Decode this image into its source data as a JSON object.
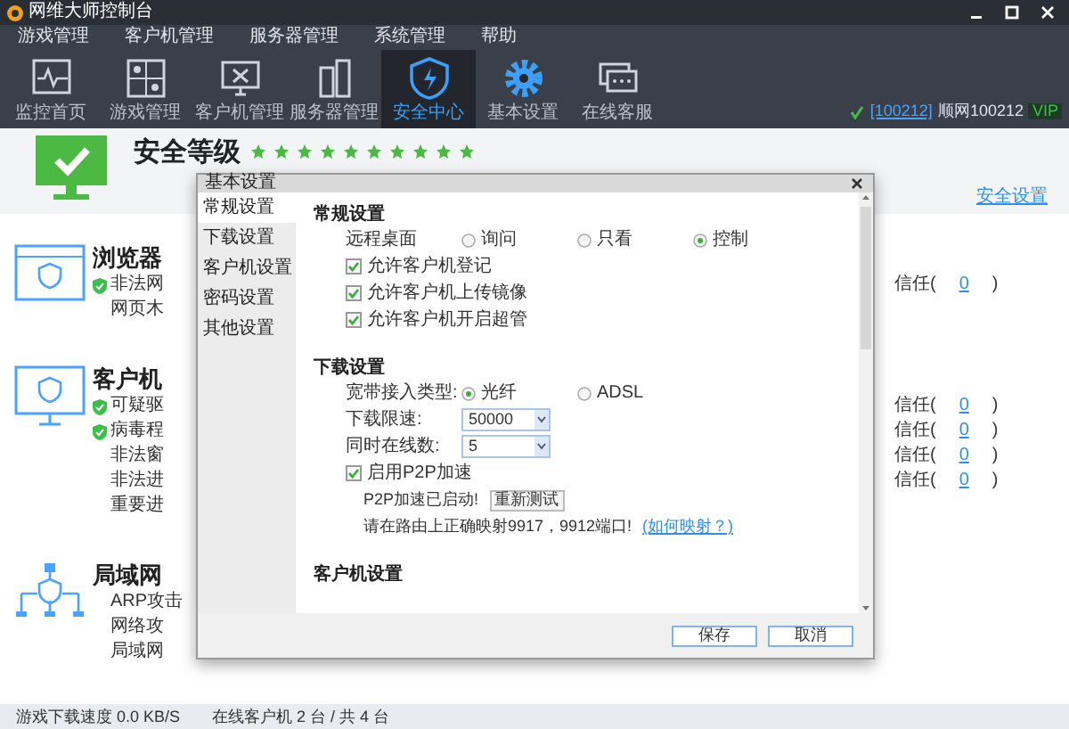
{
  "window": {
    "title": "网维大师控制台"
  },
  "menu": [
    "游戏管理",
    "客户机管理",
    "服务器管理",
    "系统管理",
    "帮助"
  ],
  "toolbar": [
    {
      "label": "监控首页",
      "kind": "monitor",
      "selected": false
    },
    {
      "label": "游戏管理",
      "kind": "games",
      "selected": false
    },
    {
      "label": "客户机管理",
      "kind": "client",
      "selected": false
    },
    {
      "label": "服务器管理",
      "kind": "server",
      "selected": false
    },
    {
      "label": "安全中心",
      "kind": "shield",
      "selected": true
    },
    {
      "label": "基本设置",
      "kind": "gear",
      "selected": false
    },
    {
      "label": "在线客服",
      "kind": "chat",
      "selected": false
    }
  ],
  "account": {
    "id": "[100212]",
    "name": "顺网100212",
    "badge": "VIP"
  },
  "security": {
    "title": "安全等级",
    "stars": 10,
    "settings_link": "安全设置",
    "sections": [
      {
        "kind": "browser",
        "title": "浏览器",
        "items": [
          {
            "text": "非法网",
            "shield": true,
            "trust": {
              "label": "信任(",
              "count": "0",
              "suffix": ")"
            }
          },
          {
            "text": "网页木",
            "shield": false
          }
        ]
      },
      {
        "kind": "client",
        "title": "客户机",
        "items": [
          {
            "text": "可疑驱",
            "shield": true,
            "trust": {
              "label": "信任(",
              "count": "0",
              "suffix": ")"
            }
          },
          {
            "text": "病毒程",
            "shield": true,
            "trust": {
              "label": "信任(",
              "count": "0",
              "suffix": ")"
            }
          },
          {
            "text": "非法窗",
            "shield": false,
            "trust": {
              "label": "信任(",
              "count": "0",
              "suffix": ")"
            }
          },
          {
            "text": "非法进",
            "shield": false,
            "trust": {
              "label": "信任(",
              "count": "0",
              "suffix": ")"
            }
          },
          {
            "text": "重要进",
            "shield": false
          }
        ]
      },
      {
        "kind": "lan",
        "title": "局域网",
        "items": [
          {
            "text": "ARP攻击",
            "shield": false
          },
          {
            "text": "网络攻",
            "shield": false
          },
          {
            "text": "局域网",
            "shield": false
          }
        ]
      }
    ]
  },
  "dialog": {
    "title": "基本设置",
    "nav": [
      {
        "label": "常规设置",
        "selected": true
      },
      {
        "label": "下载设置",
        "selected": false
      },
      {
        "label": "客户机设置",
        "selected": false
      },
      {
        "label": "密码设置",
        "selected": false
      },
      {
        "label": "其他设置",
        "selected": false
      }
    ],
    "sections": [
      {
        "title": "常规设置",
        "rows": [
          {
            "kind": "radio",
            "label": "远程桌面",
            "options": [
              {
                "label": "询问",
                "selected": false
              },
              {
                "label": "只看",
                "selected": false
              },
              {
                "label": "控制",
                "selected": true
              }
            ]
          },
          {
            "kind": "checkbox",
            "label": "允许客户机登记",
            "checked": true
          },
          {
            "kind": "checkbox",
            "label": "允许客户机上传镜像",
            "checked": true
          },
          {
            "kind": "checkbox",
            "label": "允许客户机开启超管",
            "checked": true
          }
        ]
      },
      {
        "title": "下载设置",
        "rows": [
          {
            "kind": "radio",
            "label": "宽带接入类型:",
            "options": [
              {
                "label": "光纤",
                "selected": true
              },
              {
                "label": "ADSL",
                "selected": false
              }
            ]
          },
          {
            "kind": "select",
            "label": "下载限速:",
            "value": "50000"
          },
          {
            "kind": "select",
            "label": "同时在线数:",
            "value": "5"
          },
          {
            "kind": "checkbox",
            "label": "启用P2P加速",
            "checked": true
          },
          {
            "kind": "status",
            "label": "P2P加速已启动!",
            "button": "重新测试"
          },
          {
            "kind": "note",
            "text": "请在路由上正确映射9917，9912端口!",
            "link": "(如何映射？)"
          }
        ]
      },
      {
        "title": "客户机设置"
      }
    ],
    "buttons": [
      "保存",
      "取消"
    ]
  },
  "status_bar": {
    "download_speed": "游戏下载速度 0.0 KB/S",
    "clients": "在线客户机 2 台 / 共 4 台"
  }
}
